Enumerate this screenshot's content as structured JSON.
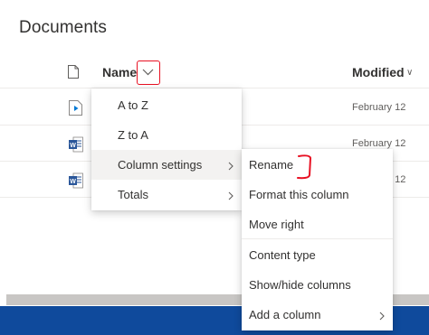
{
  "page": {
    "title": "Documents"
  },
  "header": {
    "name_label": "Name",
    "modified_label": "Modified",
    "sort_indicator": "∨"
  },
  "rows": [
    {
      "icon": "video-file-icon",
      "modified": "February 12"
    },
    {
      "icon": "word-doc-icon",
      "modified": "February 12"
    },
    {
      "icon": "word-doc-icon",
      "modified": "February 12"
    }
  ],
  "column_menu": {
    "items": [
      {
        "label": "A to Z"
      },
      {
        "label": "Z to A"
      },
      {
        "label": "Column settings",
        "active": true,
        "has_submenu": true
      },
      {
        "label": "Totals",
        "has_submenu": true
      }
    ]
  },
  "settings_submenu": {
    "items": [
      {
        "label": "Rename"
      },
      {
        "label": "Format this column"
      },
      {
        "label": "Move right"
      },
      {
        "label": "Content type"
      },
      {
        "label": "Show/hide columns"
      },
      {
        "label": "Add a column",
        "has_submenu": true
      }
    ]
  },
  "colors": {
    "accent_red": "#e81123",
    "bottom_bar": "#0f4a9c",
    "word_blue": "#2b579a"
  }
}
